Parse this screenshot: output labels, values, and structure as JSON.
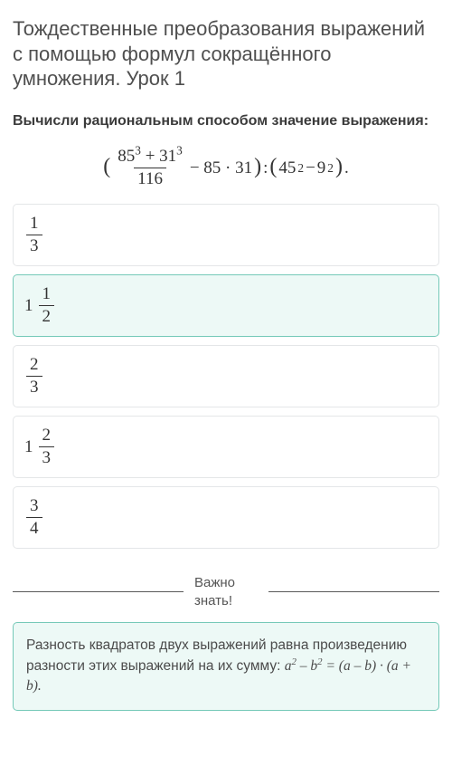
{
  "title": "Тождественные преобразования выражений с помощью формул сокращённого умножения. Урок 1",
  "prompt": "Вычисли рациональным способом значение выражения:",
  "expression": {
    "frac_num_a": "85",
    "frac_num_a_exp": "3",
    "frac_plus": " + ",
    "frac_num_b": "31",
    "frac_num_b_exp": "3",
    "frac_den": "116",
    "minus": " − 85 · 31",
    "divide": " : ",
    "right_a": "45",
    "right_a_exp": "2",
    "right_minus": " − ",
    "right_b": "9",
    "right_b_exp": "2",
    "period": "."
  },
  "options": [
    {
      "whole": "",
      "num": "1",
      "den": "3",
      "selected": false
    },
    {
      "whole": "1",
      "num": "1",
      "den": "2",
      "selected": true
    },
    {
      "whole": "",
      "num": "2",
      "den": "3",
      "selected": false
    },
    {
      "whole": "1",
      "num": "2",
      "den": "3",
      "selected": false
    },
    {
      "whole": "",
      "num": "3",
      "den": "4",
      "selected": false
    }
  ],
  "separator": "Важно знать!",
  "hint": {
    "text": "Разность квадратов двух выражений равна произведению разности этих выражений на их сумму: ",
    "formula_a": "a",
    "formula_exp": "2",
    "formula_minus": " – ",
    "formula_b": "b",
    "formula_eq": " = (",
    "formula_amb": "a – b",
    "formula_mid": ") · (",
    "formula_apb": "a + b",
    "formula_end": ")."
  }
}
